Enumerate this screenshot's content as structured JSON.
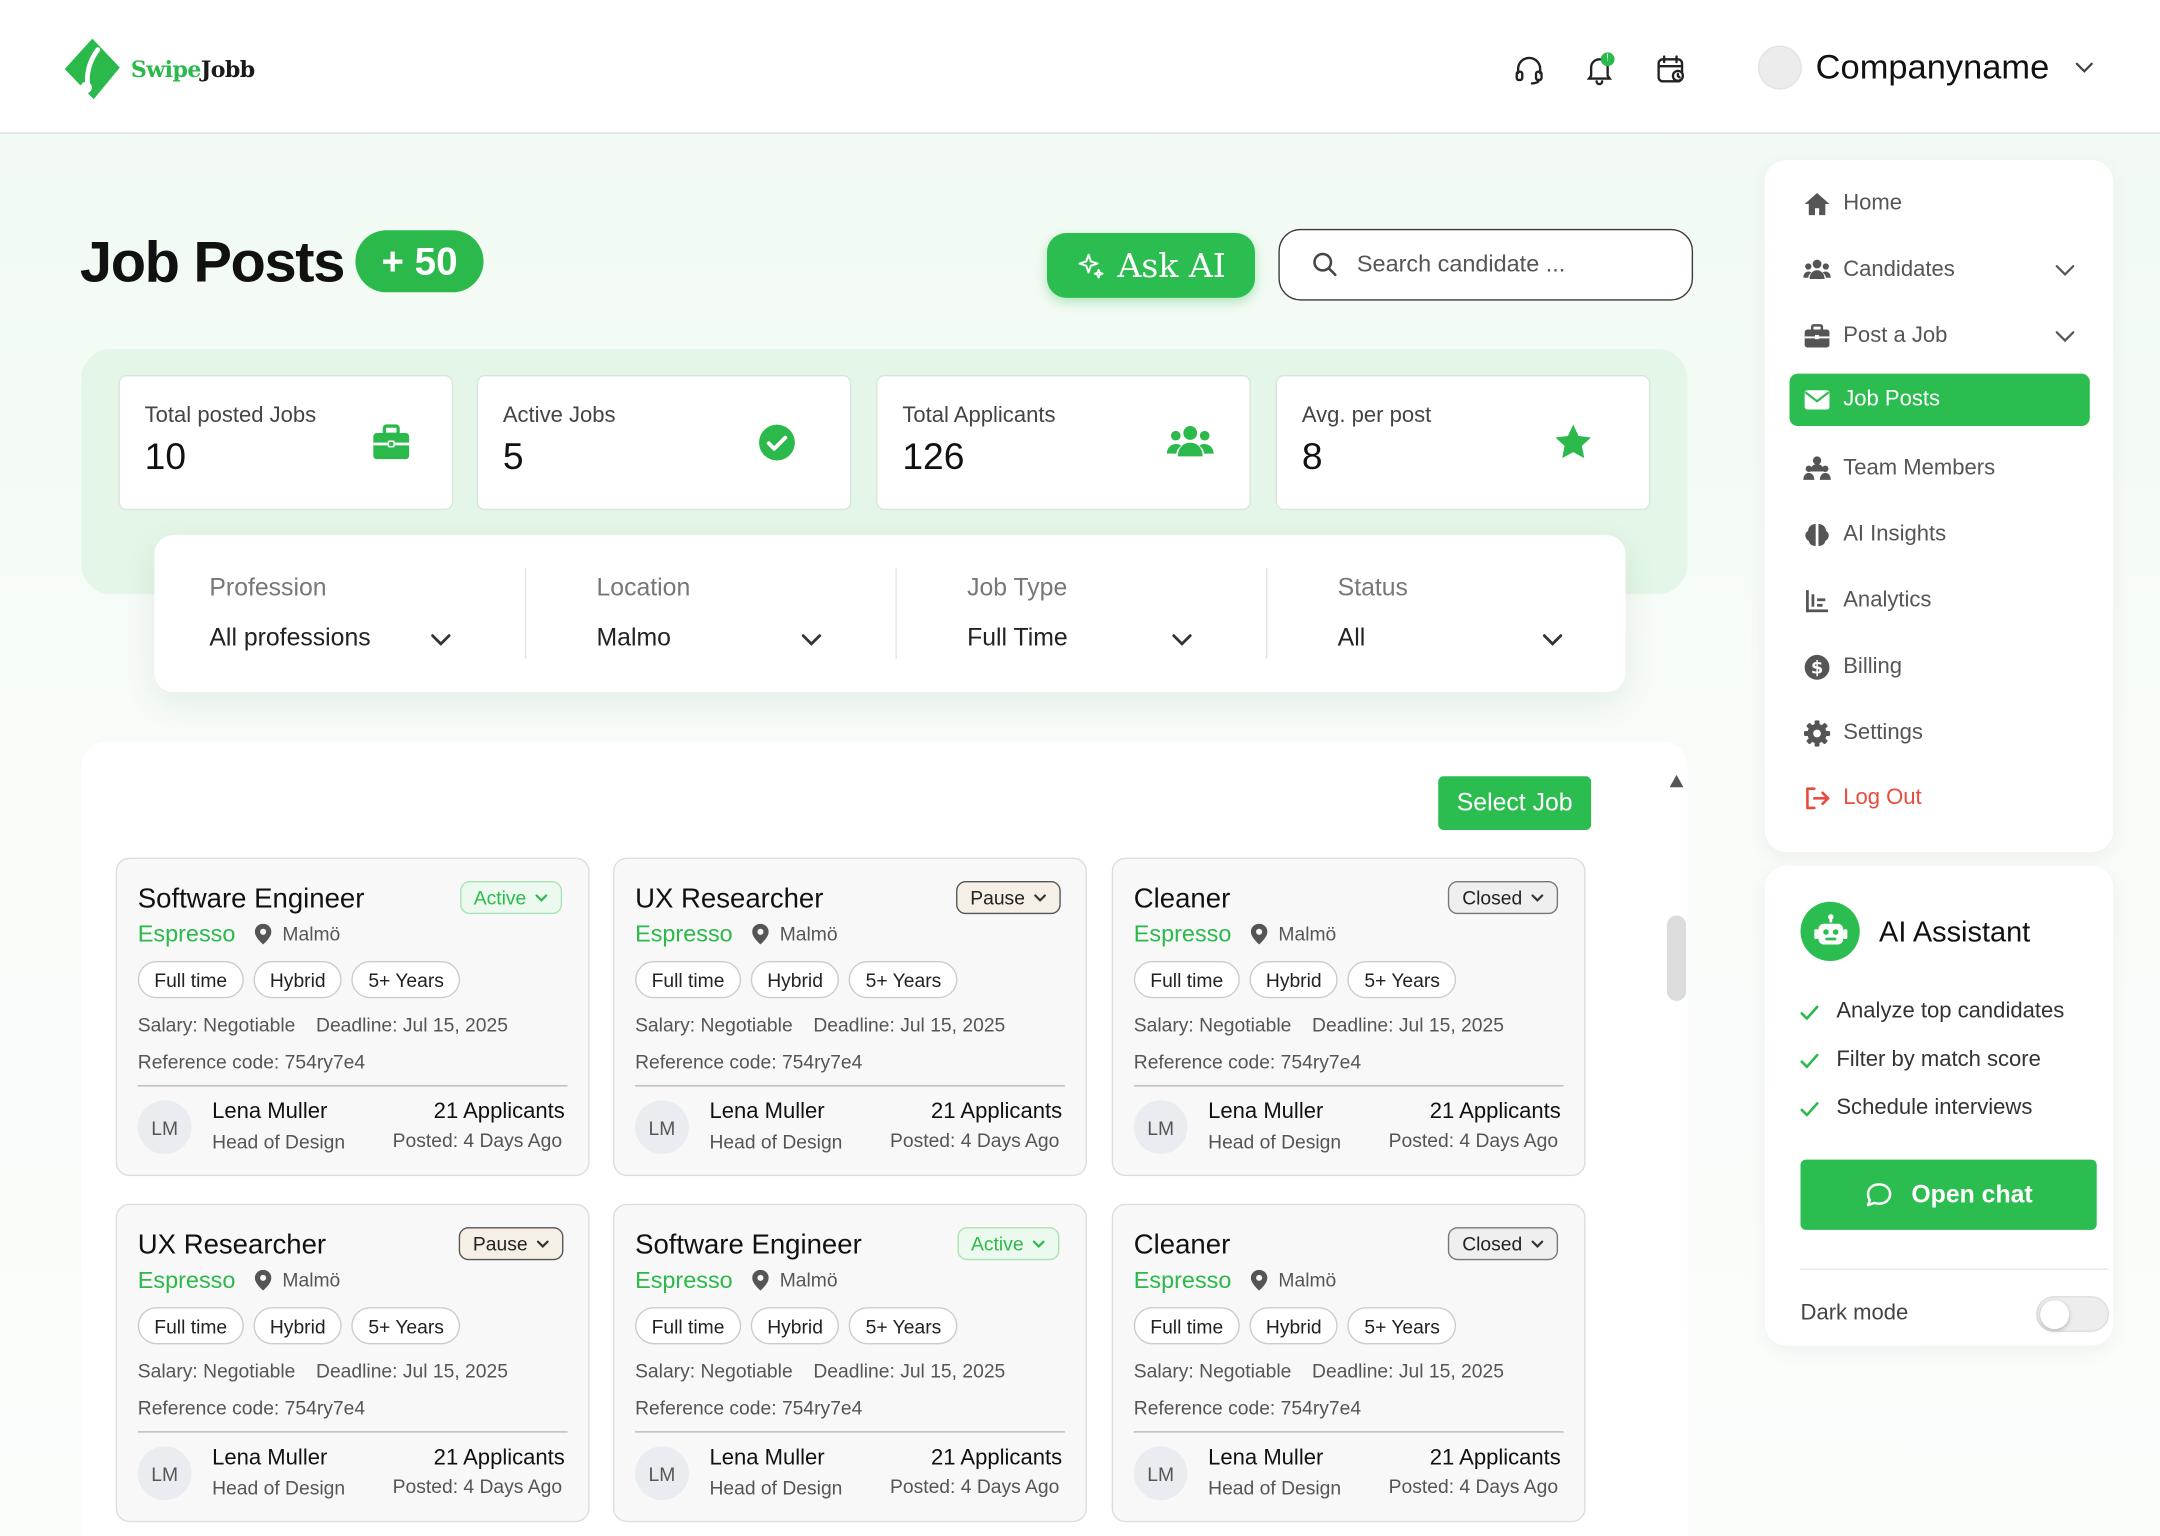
{
  "brand": {
    "name_part1": "Swipe",
    "name_part2": "Jobb",
    "color": "#2bb94c"
  },
  "header": {
    "icons": [
      "headset-icon",
      "bell-icon",
      "calendar-icon"
    ],
    "notification_badge": "!",
    "company_name": "Companyname"
  },
  "page": {
    "title": "Job Posts",
    "count_badge": "+ 50"
  },
  "ask_ai": {
    "label": "Ask AI"
  },
  "search": {
    "placeholder": "Search candidate ..."
  },
  "stats": [
    {
      "label": "Total posted Jobs",
      "value": "10",
      "icon": "briefcase-icon"
    },
    {
      "label": "Active Jobs",
      "value": "5",
      "icon": "check-circle-icon"
    },
    {
      "label": "Total Applicants",
      "value": "126",
      "icon": "users-icon"
    },
    {
      "label": "Avg. per post",
      "value": "8",
      "icon": "star-icon"
    }
  ],
  "filters": [
    {
      "label": "Profession",
      "value": "All professions"
    },
    {
      "label": "Location",
      "value": "Malmo"
    },
    {
      "label": "Job Type",
      "value": "Full Time"
    },
    {
      "label": "Status",
      "value": "All"
    }
  ],
  "select_job": {
    "label": "Select Job"
  },
  "jobs": [
    {
      "title": "Software Engineer",
      "status": "Active",
      "company": "Espresso",
      "location": "Malmö",
      "tags": [
        "Full time",
        "Hybrid",
        "5+ Years"
      ],
      "salary": "Salary: Negotiable",
      "deadline": "Deadline: Jul 15, 2025",
      "reference": "Reference code: 754ry7e4",
      "initials": "LM",
      "person": "Lena Muller",
      "role": "Head of Design",
      "applicants": "21 Applicants",
      "posted": "Posted: 4 Days Ago"
    },
    {
      "title": "UX Researcher",
      "status": "Pause",
      "company": "Espresso",
      "location": "Malmö",
      "tags": [
        "Full time",
        "Hybrid",
        "5+ Years"
      ],
      "salary": "Salary: Negotiable",
      "deadline": "Deadline: Jul 15, 2025",
      "reference": "Reference code: 754ry7e4",
      "initials": "LM",
      "person": "Lena Muller",
      "role": "Head of Design",
      "applicants": "21 Applicants",
      "posted": "Posted: 4 Days Ago"
    },
    {
      "title": "Cleaner",
      "status": "Closed",
      "company": "Espresso",
      "location": "Malmö",
      "tags": [
        "Full time",
        "Hybrid",
        "5+ Years"
      ],
      "salary": "Salary: Negotiable",
      "deadline": "Deadline: Jul 15, 2025",
      "reference": "Reference code: 754ry7e4",
      "initials": "LM",
      "person": "Lena Muller",
      "role": "Head of Design",
      "applicants": "21 Applicants",
      "posted": "Posted: 4 Days Ago"
    },
    {
      "title": "UX Researcher",
      "status": "Pause",
      "company": "Espresso",
      "location": "Malmö",
      "tags": [
        "Full time",
        "Hybrid",
        "5+ Years"
      ],
      "salary": "Salary: Negotiable",
      "deadline": "Deadline: Jul 15, 2025",
      "reference": "Reference code: 754ry7e4",
      "initials": "LM",
      "person": "Lena Muller",
      "role": "Head of Design",
      "applicants": "21 Applicants",
      "posted": "Posted: 4 Days Ago"
    },
    {
      "title": "Software Engineer",
      "status": "Active",
      "company": "Espresso",
      "location": "Malmö",
      "tags": [
        "Full time",
        "Hybrid",
        "5+ Years"
      ],
      "salary": "Salary: Negotiable",
      "deadline": "Deadline: Jul 15, 2025",
      "reference": "Reference code: 754ry7e4",
      "initials": "LM",
      "person": "Lena Muller",
      "role": "Head of Design",
      "applicants": "21 Applicants",
      "posted": "Posted: 4 Days Ago"
    },
    {
      "title": "Cleaner",
      "status": "Closed",
      "company": "Espresso",
      "location": "Malmö",
      "tags": [
        "Full time",
        "Hybrid",
        "5+ Years"
      ],
      "salary": "Salary: Negotiable",
      "deadline": "Deadline: Jul 15, 2025",
      "reference": "Reference code: 754ry7e4",
      "initials": "LM",
      "person": "Lena Muller",
      "role": "Head of Design",
      "applicants": "21 Applicants",
      "posted": "Posted: 4 Days Ago"
    }
  ],
  "sidebar": {
    "items": [
      {
        "label": "Home",
        "icon": "home-icon"
      },
      {
        "label": "Candidates",
        "icon": "users-icon",
        "expandable": true
      },
      {
        "label": "Post a Job",
        "icon": "briefcase-icon",
        "expandable": true
      },
      {
        "label": "Job Posts",
        "icon": "envelope-icon",
        "active": true
      },
      {
        "label": "Team Members",
        "icon": "team-icon"
      },
      {
        "label": "AI Insights",
        "icon": "brain-icon"
      },
      {
        "label": "Analytics",
        "icon": "chart-icon"
      },
      {
        "label": "Billing",
        "icon": "dollar-icon"
      },
      {
        "label": "Settings",
        "icon": "gear-icon"
      },
      {
        "label": "Log Out",
        "icon": "logout-icon",
        "danger": true
      }
    ]
  },
  "ai_assistant": {
    "title": "AI Assistant",
    "features": [
      "Analyze top candidates",
      "Filter by match score",
      "Schedule interviews"
    ],
    "open_chat": "Open chat",
    "dark_mode_label": "Dark mode",
    "dark_mode_on": false
  },
  "colors": {
    "accent": "#2bbd4f",
    "danger": "#e74c3c",
    "pause_bg": "#f6efe6",
    "active_bg": "#ebf9ee"
  }
}
